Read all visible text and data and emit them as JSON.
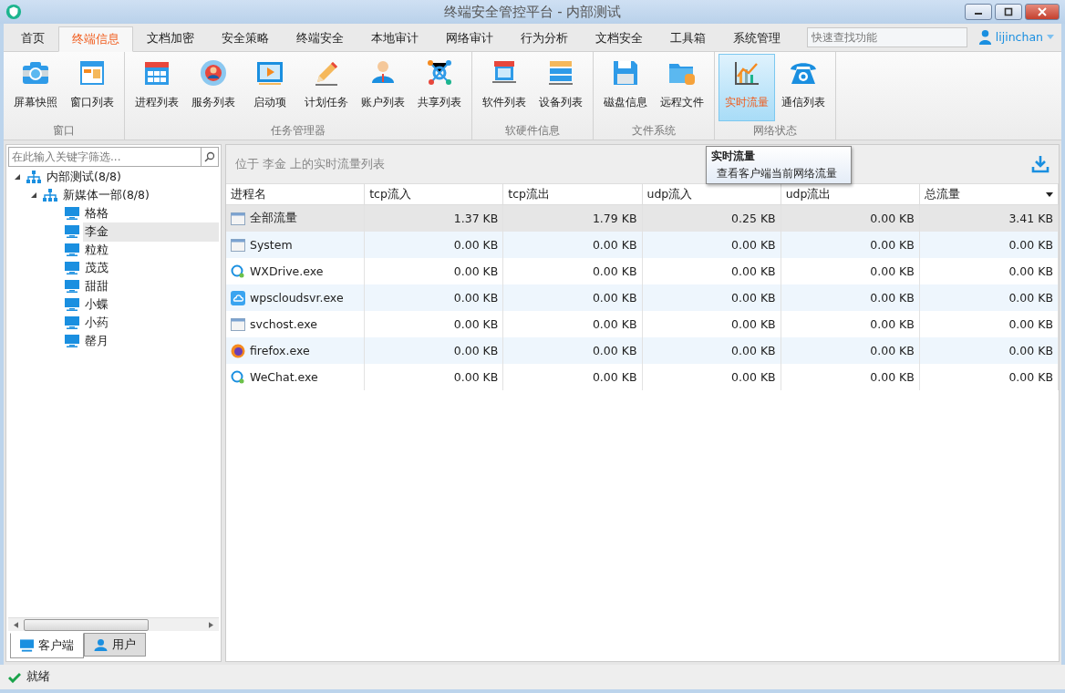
{
  "window": {
    "title": "终端安全管控平台 - 内部测试"
  },
  "tabs": [
    {
      "label": "首页",
      "selected": false
    },
    {
      "label": "终端信息",
      "selected": true
    },
    {
      "label": "文档加密",
      "selected": false
    },
    {
      "label": "安全策略",
      "selected": false
    },
    {
      "label": "终端安全",
      "selected": false
    },
    {
      "label": "本地审计",
      "selected": false
    },
    {
      "label": "网络审计",
      "selected": false
    },
    {
      "label": "行为分析",
      "selected": false
    },
    {
      "label": "文档安全",
      "selected": false
    },
    {
      "label": "工具箱",
      "selected": false
    },
    {
      "label": "系统管理",
      "selected": false
    }
  ],
  "quick_search": {
    "placeholder": "快速查找功能"
  },
  "user": {
    "name": "lijinchan"
  },
  "ribbon": [
    {
      "group": "窗口",
      "buttons": [
        {
          "label": "屏幕快照",
          "selected": false
        },
        {
          "label": "窗口列表",
          "selected": false
        }
      ]
    },
    {
      "group": "任务管理器",
      "buttons": [
        {
          "label": "进程列表",
          "selected": false
        },
        {
          "label": "服务列表",
          "selected": false
        },
        {
          "label": "启动项",
          "selected": false
        },
        {
          "label": "计划任务",
          "selected": false
        },
        {
          "label": "账户列表",
          "selected": false
        },
        {
          "label": "共享列表",
          "selected": false
        }
      ]
    },
    {
      "group": "软硬件信息",
      "buttons": [
        {
          "label": "软件列表",
          "selected": false
        },
        {
          "label": "设备列表",
          "selected": false
        }
      ]
    },
    {
      "group": "文件系统",
      "buttons": [
        {
          "label": "磁盘信息",
          "selected": false
        },
        {
          "label": "远程文件",
          "selected": false
        }
      ]
    },
    {
      "group": "网络状态",
      "buttons": [
        {
          "label": "实时流量",
          "selected": true
        },
        {
          "label": "通信列表",
          "selected": false
        }
      ]
    }
  ],
  "tooltip": {
    "title": "实时流量",
    "text": "查看客户端当前网络流量"
  },
  "sidebar": {
    "filter": {
      "placeholder": "在此输入关键字筛选..."
    },
    "tree": [
      {
        "label": "内部测试(8/8)",
        "expanded": true,
        "selected": false,
        "children": [
          {
            "label": "新媒体一部(8/8)",
            "expanded": true,
            "selected": false,
            "children": [
              {
                "label": "格格",
                "selected": false
              },
              {
                "label": "李金",
                "selected": true
              },
              {
                "label": "粒粒",
                "selected": false
              },
              {
                "label": "茂茂",
                "selected": false
              },
              {
                "label": "甜甜",
                "selected": false
              },
              {
                "label": "小蝶",
                "selected": false
              },
              {
                "label": "小药",
                "selected": false
              },
              {
                "label": "罄月",
                "selected": false
              }
            ]
          }
        ]
      }
    ],
    "bottom_tabs": [
      {
        "label": "客户端",
        "selected": true
      },
      {
        "label": "用户",
        "selected": false
      }
    ]
  },
  "main": {
    "caption": "位于 李金 上的实时流量列表",
    "table": {
      "columns": [
        "进程名",
        "tcp流入",
        "tcp流出",
        "udp流入",
        "udp流出",
        "总流量"
      ],
      "rows": [
        {
          "selected": true,
          "cells": [
            "全部流量",
            "1.37 KB",
            "1.79 KB",
            "0.25 KB",
            "0.00 KB",
            "3.41 KB"
          ]
        },
        {
          "selected": false,
          "cells": [
            "System",
            "0.00 KB",
            "0.00 KB",
            "0.00 KB",
            "0.00 KB",
            "0.00 KB"
          ]
        },
        {
          "selected": false,
          "cells": [
            "WXDrive.exe",
            "0.00 KB",
            "0.00 KB",
            "0.00 KB",
            "0.00 KB",
            "0.00 KB"
          ]
        },
        {
          "selected": false,
          "cells": [
            "wpscloudsvr.exe",
            "0.00 KB",
            "0.00 KB",
            "0.00 KB",
            "0.00 KB",
            "0.00 KB"
          ]
        },
        {
          "selected": false,
          "cells": [
            "svchost.exe",
            "0.00 KB",
            "0.00 KB",
            "0.00 KB",
            "0.00 KB",
            "0.00 KB"
          ]
        },
        {
          "selected": false,
          "cells": [
            "firefox.exe",
            "0.00 KB",
            "0.00 KB",
            "0.00 KB",
            "0.00 KB",
            "0.00 KB"
          ]
        },
        {
          "selected": false,
          "cells": [
            "WeChat.exe",
            "0.00 KB",
            "0.00 KB",
            "0.00 KB",
            "0.00 KB",
            "0.00 KB"
          ]
        }
      ]
    }
  },
  "status_bar": {
    "text": "就绪"
  }
}
